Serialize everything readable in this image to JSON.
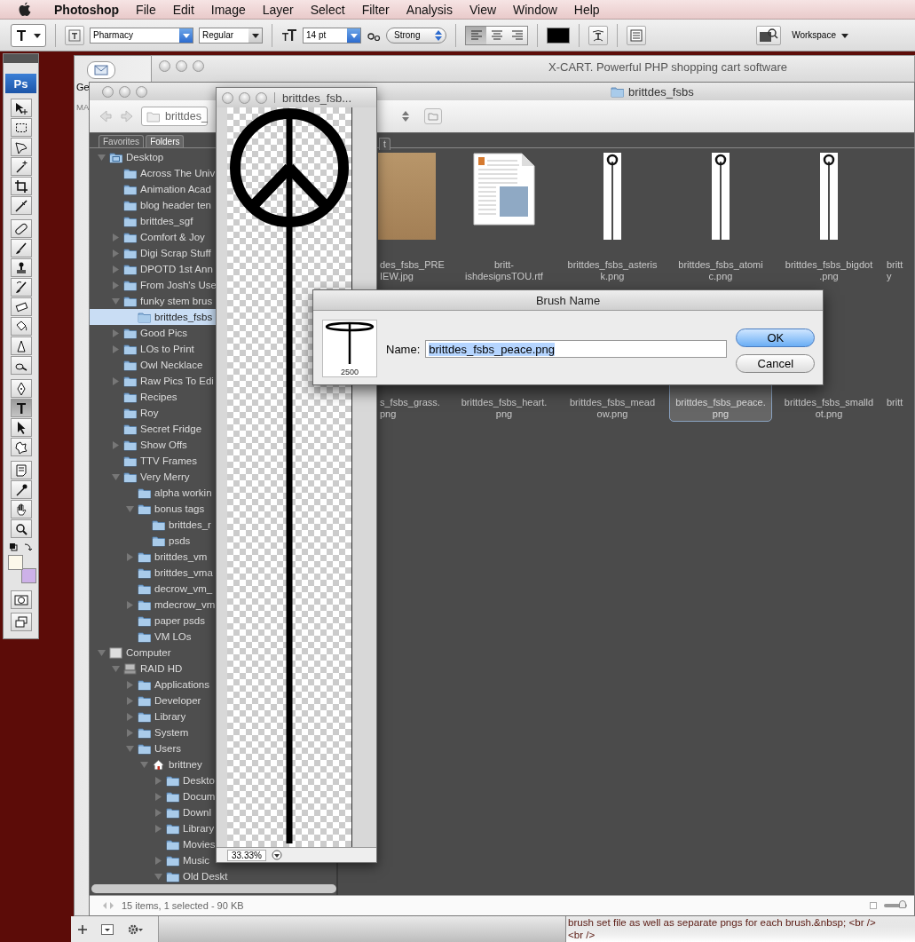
{
  "menu_bar": {
    "app": "Photoshop",
    "items": [
      "File",
      "Edit",
      "Image",
      "Layer",
      "Select",
      "Filter",
      "Analysis",
      "View",
      "Window",
      "Help"
    ]
  },
  "options_bar": {
    "font_family": "Pharmacy",
    "font_style": "Regular",
    "font_size": "14 pt",
    "antialias": "Strong",
    "align": [
      {
        "selected": true
      },
      {
        "selected": false
      },
      {
        "selected": false
      }
    ],
    "workspace": "Workspace"
  },
  "tools_logo": "Ps",
  "tools": [
    {
      "kind": "move",
      "selected": false
    },
    {
      "kind": "marquee",
      "selected": false
    },
    {
      "kind": "lasso",
      "selected": false
    },
    {
      "kind": "wand",
      "selected": false
    },
    {
      "kind": "crop",
      "selected": false
    },
    {
      "kind": "slice",
      "selected": false
    },
    {
      "kind": "heal",
      "selected": false
    },
    {
      "kind": "brush",
      "selected": false
    },
    {
      "kind": "stamp",
      "selected": false
    },
    {
      "kind": "history",
      "selected": false
    },
    {
      "kind": "eraser",
      "selected": false
    },
    {
      "kind": "bucket",
      "selected": false
    },
    {
      "kind": "blur",
      "selected": false
    },
    {
      "kind": "dodge",
      "selected": false
    },
    {
      "kind": "pen",
      "selected": false
    },
    {
      "kind": "type",
      "selected": true
    },
    {
      "kind": "select",
      "selected": false
    },
    {
      "kind": "shape",
      "selected": false
    },
    {
      "kind": "notes",
      "selected": false
    },
    {
      "kind": "eyedropper",
      "selected": false
    },
    {
      "kind": "hand",
      "selected": false
    },
    {
      "kind": "zoom",
      "selected": false
    }
  ],
  "browser_window": {
    "button_label": "Ge",
    "tab_label": "MA",
    "title": "X-CART. Powerful PHP shopping cart software"
  },
  "bridge": {
    "title": "brittdes_fsbs",
    "path": "brittdes_",
    "tabs": [
      {
        "label": "Favorites",
        "selected": false
      },
      {
        "label": "Folders",
        "selected": true
      }
    ],
    "content_tab": "t",
    "tree": [
      {
        "label": "Desktop",
        "kind": "desktop",
        "expanded": true,
        "selected": false,
        "children": [
          {
            "label": "Across The Univ",
            "kind": "folder",
            "selected": false
          },
          {
            "label": "Animation Acad",
            "kind": "folder",
            "selected": false
          },
          {
            "label": "blog header ten",
            "kind": "folder",
            "selected": false
          },
          {
            "label": "brittdes_sgf",
            "kind": "folder",
            "selected": false
          },
          {
            "label": "Comfort & Joy",
            "kind": "folder",
            "expanded": false,
            "selected": false
          },
          {
            "label": "Digi Scrap Stuff",
            "kind": "folder",
            "expanded": false,
            "selected": false
          },
          {
            "label": "DPOTD 1st Ann",
            "kind": "folder",
            "expanded": false,
            "selected": false
          },
          {
            "label": "From Josh's Use",
            "kind": "folder",
            "expanded": false,
            "selected": false
          },
          {
            "label": "funky stem brus",
            "kind": "folder",
            "expanded": true,
            "selected": false,
            "children": [
              {
                "label": "brittdes_fsbs",
                "kind": "folder",
                "selected": true
              }
            ]
          },
          {
            "label": "Good Pics",
            "kind": "folder",
            "expanded": false,
            "selected": false
          },
          {
            "label": "LOs to Print",
            "kind": "folder",
            "expanded": false,
            "selected": false
          },
          {
            "label": "Owl Necklace",
            "kind": "folder",
            "selected": false
          },
          {
            "label": "Raw Pics To Edi",
            "kind": "folder",
            "expanded": false,
            "selected": false
          },
          {
            "label": "Recipes",
            "kind": "folder",
            "selected": false
          },
          {
            "label": "Roy",
            "kind": "folder",
            "selected": false
          },
          {
            "label": "Secret Fridge",
            "kind": "folder",
            "selected": false
          },
          {
            "label": "Show Offs",
            "kind": "folder",
            "expanded": false,
            "selected": false
          },
          {
            "label": "TTV Frames",
            "kind": "folder",
            "selected": false
          },
          {
            "label": "Very Merry",
            "kind": "folder",
            "expanded": true,
            "selected": false,
            "children": [
              {
                "label": "alpha workin",
                "kind": "folder",
                "selected": false
              },
              {
                "label": "bonus tags",
                "kind": "folder",
                "expanded": true,
                "selected": false,
                "children": [
                  {
                    "label": "brittdes_r",
                    "kind": "folder",
                    "selected": false
                  },
                  {
                    "label": "psds",
                    "kind": "folder",
                    "selected": false
                  }
                ]
              },
              {
                "label": "brittdes_vm",
                "kind": "folder",
                "expanded": false,
                "selected": false
              },
              {
                "label": "brittdes_vma",
                "kind": "folder",
                "selected": false
              },
              {
                "label": "decrow_vm_",
                "kind": "folder",
                "selected": false
              },
              {
                "label": "mdecrow_vm",
                "kind": "folder",
                "expanded": false,
                "selected": false
              },
              {
                "label": "paper psds",
                "kind": "folder",
                "selected": false
              },
              {
                "label": "VM LOs",
                "kind": "folder",
                "selected": false
              }
            ]
          }
        ]
      },
      {
        "label": "Computer",
        "kind": "computer",
        "expanded": true,
        "selected": false,
        "children": [
          {
            "label": "RAID HD",
            "kind": "drive",
            "expanded": true,
            "selected": false,
            "children": [
              {
                "label": "Applications",
                "kind": "folder",
                "expanded": false,
                "selected": false
              },
              {
                "label": "Developer",
                "kind": "folder",
                "expanded": false,
                "selected": false
              },
              {
                "label": "Library",
                "kind": "folder",
                "expanded": false,
                "selected": false
              },
              {
                "label": "System",
                "kind": "folder",
                "expanded": false,
                "selected": false
              },
              {
                "label": "Users",
                "kind": "folder",
                "expanded": true,
                "selected": false,
                "children": [
                  {
                    "label": "brittney",
                    "kind": "home",
                    "expanded": true,
                    "selected": false,
                    "children": [
                      {
                        "label": "Deskto",
                        "kind": "folder",
                        "expanded": false,
                        "selected": false
                      },
                      {
                        "label": "Docum",
                        "kind": "folder",
                        "expanded": false,
                        "selected": false
                      },
                      {
                        "label": "Downl",
                        "kind": "folder",
                        "expanded": false,
                        "selected": false
                      },
                      {
                        "label": "Library",
                        "kind": "folder",
                        "expanded": false,
                        "selected": false
                      },
                      {
                        "label": "Movies",
                        "kind": "folder",
                        "selected": false
                      },
                      {
                        "label": "Music",
                        "kind": "folder",
                        "expanded": false,
                        "selected": false
                      },
                      {
                        "label": "Old Deskt",
                        "kind": "folder",
                        "expanded": true,
                        "selected": false
                      }
                    ]
                  }
                ]
              }
            ]
          }
        ]
      }
    ],
    "files": [
      {
        "lines": [
          "des_fsbs_PRE",
          "IEW.jpg"
        ],
        "kind": "photo",
        "selected": false
      },
      {
        "lines": [
          "britt-",
          "ishdesignsTOU.rtf"
        ],
        "kind": "document",
        "selected": false
      },
      {
        "lines": [
          "brittdes_fsbs_asteris",
          "k.png"
        ],
        "kind": "brush",
        "selected": false
      },
      {
        "lines": [
          "brittdes_fsbs_atomi",
          "c.png"
        ],
        "kind": "brush",
        "selected": false
      },
      {
        "lines": [
          "brittdes_fsbs_bigdot",
          ".png"
        ],
        "kind": "brush",
        "selected": false
      },
      {
        "lines": [
          "britt",
          "y"
        ],
        "kind": "none",
        "selected": false
      },
      {
        "lines": [
          "s_fsbs_grass.",
          "png"
        ],
        "kind": "none",
        "selected": false
      },
      {
        "lines": [
          "brittdes_fsbs_heart.",
          "png"
        ],
        "kind": "none",
        "selected": false
      },
      {
        "lines": [
          "brittdes_fsbs_mead",
          "ow.png"
        ],
        "kind": "none",
        "selected": false
      },
      {
        "lines": [
          "brittdes_fsbs_peace.",
          "png"
        ],
        "kind": "none",
        "selected": true
      },
      {
        "lines": [
          "brittdes_fsbs_smalld",
          "ot.png"
        ],
        "kind": "none",
        "selected": false
      },
      {
        "lines": [
          "britt"
        ],
        "kind": "none",
        "selected": false
      }
    ],
    "status": "15 items, 1 selected - 90 KB",
    "thumbnail_size": {
      "level": 0.8
    }
  },
  "image_window": {
    "title": "brittdes_fsb...",
    "zoom": "33.33%"
  },
  "dialog": {
    "title": "Brush Name",
    "preview_size": "2500",
    "name_label": "Name:",
    "name_value": "brittdes_fsbs_peace.png",
    "buttons": [
      {
        "label": "OK",
        "kind": "default"
      },
      {
        "label": "Cancel",
        "kind": "normal"
      }
    ]
  },
  "editor": {
    "lines": [
      "brush set file as well as separate pngs for each brush.&nbsp; <br />",
      "<br />"
    ]
  }
}
